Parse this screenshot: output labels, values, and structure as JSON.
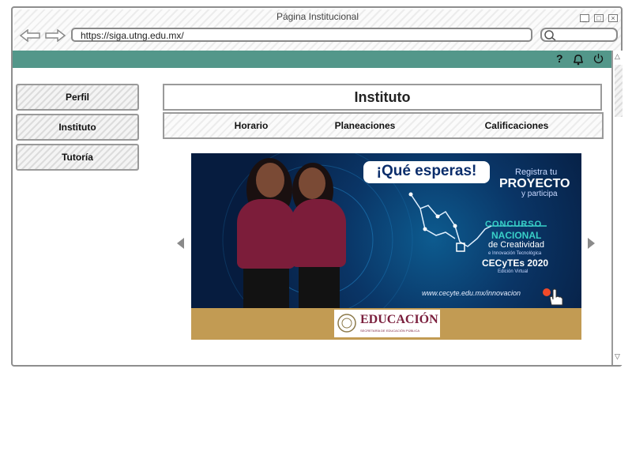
{
  "window": {
    "title": "Página Institucional",
    "url": "https://siga.utng.edu.mx/",
    "controls": [
      "minimize-icon",
      "maximize-icon",
      "close-icon"
    ]
  },
  "topbar": {
    "icons": [
      "help-icon",
      "bell-icon",
      "power-icon"
    ],
    "help_glyph": "?",
    "accent": "#53978a"
  },
  "sidebar": {
    "items": [
      {
        "label": "Perfil"
      },
      {
        "label": "Instituto"
      },
      {
        "label": "Tutoría"
      }
    ]
  },
  "main": {
    "title": "Instituto",
    "tabs": [
      {
        "label": "Horario"
      },
      {
        "label": "Planeaciones"
      },
      {
        "label": "Calificaciones"
      }
    ]
  },
  "banner": {
    "headline": "¡Qué esperas!",
    "cta_small": "Registra tu",
    "cta_big": "PROYECTO",
    "cta_tail": "y participa",
    "contest_line1": "CONCURSO",
    "contest_line2": "NACIONAL",
    "contest_line3": "de Creatividad",
    "contest_line4": "e Innovación Tecnológica",
    "contest_line5": "CECyTEs 2020",
    "contest_line6": "Edición Virtual",
    "link": "www.cecyte.edu.mx/innovacion",
    "footer_logo": "EDUCACIÓN",
    "footer_sub": "SECRETARÍA DE EDUCACIÓN PÚBLICA"
  }
}
